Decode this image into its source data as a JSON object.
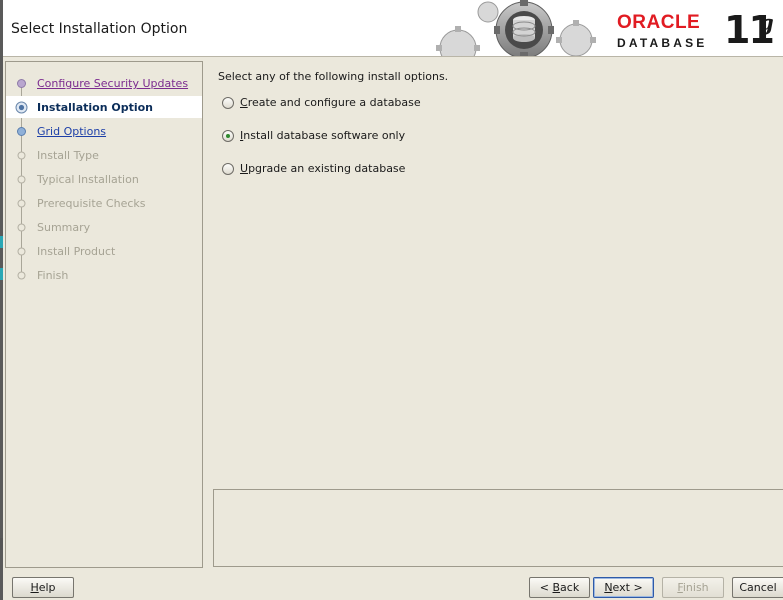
{
  "header": {
    "title": "Select Installation Option",
    "brand_name": "ORACLE",
    "brand_product": "DATABASE",
    "brand_version": "11",
    "brand_version_suffix": "g",
    "brand_color": "#e11b22"
  },
  "steps": [
    {
      "label": "Configure Security Updates",
      "state": "visited"
    },
    {
      "label": "Installation Option",
      "state": "current"
    },
    {
      "label": "Grid Options",
      "state": "link"
    },
    {
      "label": "Install Type",
      "state": "disabled"
    },
    {
      "label": "Typical Installation",
      "state": "disabled"
    },
    {
      "label": "Prerequisite Checks",
      "state": "disabled"
    },
    {
      "label": "Summary",
      "state": "disabled"
    },
    {
      "label": "Install Product",
      "state": "disabled"
    },
    {
      "label": "Finish",
      "state": "disabled"
    }
  ],
  "main": {
    "prompt": "Select any of the following install options.",
    "options": [
      {
        "mnemonic": "C",
        "rest": "reate and configure a database",
        "selected": false
      },
      {
        "mnemonic": "I",
        "rest": "nstall database software only",
        "selected": true
      },
      {
        "mnemonic": "U",
        "rest": "pgrade an existing database",
        "selected": false
      }
    ],
    "message": ""
  },
  "buttons": {
    "help": {
      "mnemonic": "H",
      "rest": "elp"
    },
    "back": {
      "prefix": "< ",
      "mnemonic": "B",
      "rest": "ack"
    },
    "next": {
      "mnemonic": "N",
      "rest": "ext >"
    },
    "finish": {
      "mnemonic": "F",
      "rest": "inish"
    },
    "cancel": {
      "label": "Cancel"
    }
  }
}
